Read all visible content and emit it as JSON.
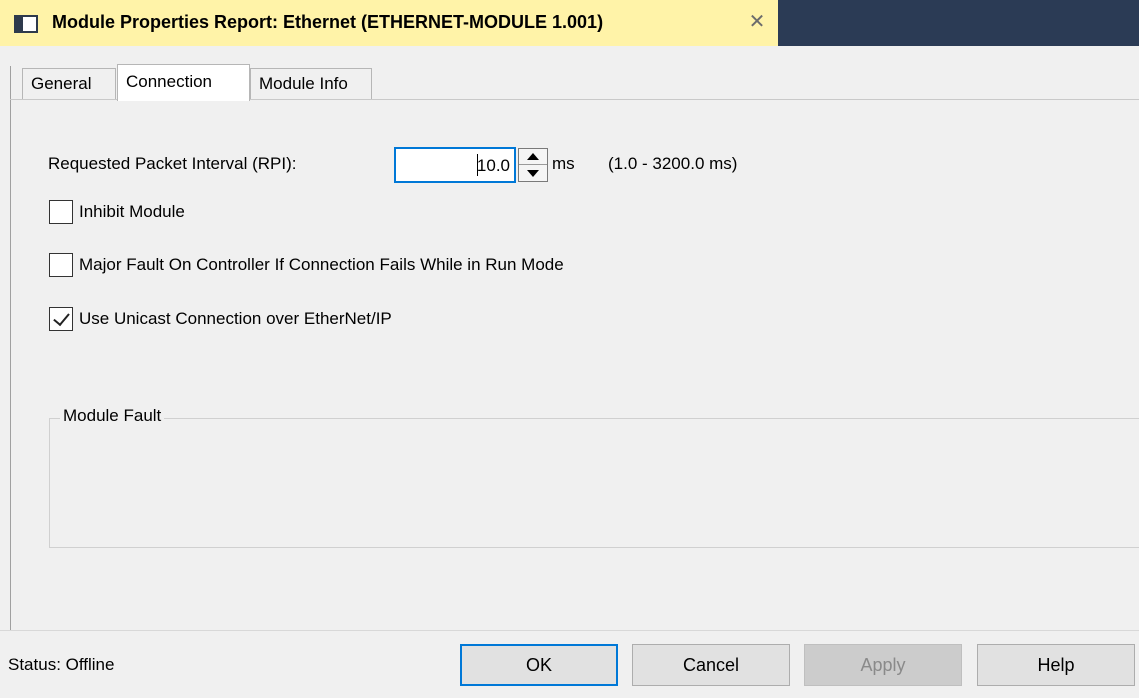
{
  "window": {
    "title": "Module Properties Report: Ethernet (ETHERNET-MODULE 1.001)",
    "close_glyph": "✕",
    "icon": "module-icon"
  },
  "tabs": [
    {
      "label": "General",
      "active": false
    },
    {
      "label": "Connection",
      "active": true
    },
    {
      "label": "Module Info",
      "active": false
    }
  ],
  "connection": {
    "rpi_label": "Requested Packet Interval (RPI):",
    "rpi_value": "10.0",
    "rpi_unit": "ms",
    "rpi_range": "(1.0 - 3200.0 ms)",
    "inhibit_label": "Inhibit Module",
    "inhibit_checked": false,
    "major_fault_label": "Major Fault On Controller If Connection Fails While in Run Mode",
    "major_fault_checked": false,
    "unicast_label": "Use Unicast Connection over EtherNet/IP",
    "unicast_checked": true,
    "module_fault_label": "Module Fault",
    "module_fault_text": ""
  },
  "footer": {
    "status": "Status:  Offline",
    "ok": "OK",
    "cancel": "Cancel",
    "apply": "Apply",
    "help": "Help"
  },
  "colors": {
    "title_tab_bg": "#fff3a8",
    "titlebar_bg": "#2b3b55",
    "focus_blue": "#0078d7",
    "dialog_bg": "#f0f0f0"
  }
}
